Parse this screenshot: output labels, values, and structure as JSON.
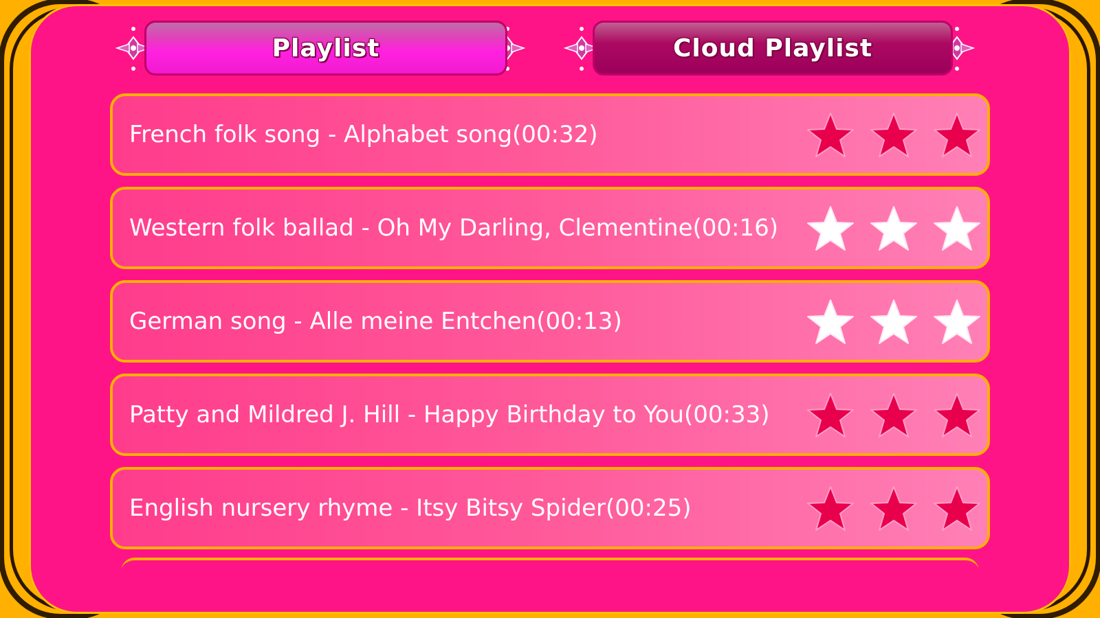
{
  "tabs": {
    "playlist_label": "Playlist",
    "cloud_playlist_label": "Cloud Playlist"
  },
  "songs": [
    {
      "title": "French folk song - Alphabet song(00:32)",
      "stars_filled": 3,
      "stars_total": 3
    },
    {
      "title": "Western folk ballad - Oh My Darling, Clementine(00:16)",
      "stars_filled": 0,
      "stars_total": 3
    },
    {
      "title": "German song - Alle meine Entchen(00:13)",
      "stars_filled": 0,
      "stars_total": 3
    },
    {
      "title": "Patty and Mildred J. Hill - Happy Birthday to You(00:33)",
      "stars_filled": 3,
      "stars_total": 3
    },
    {
      "title": "English nursery rhyme - Itsy Bitsy Spider(00:25)",
      "stars_filled": 3,
      "stars_total": 3
    }
  ],
  "colors": {
    "background": "#ffb000",
    "panel": "#fe1487",
    "star_filled": "#e8004c",
    "star_empty": "#ffffff",
    "row_border": "#ffb000"
  },
  "icons": {
    "tab_ornament": "flower-ornament-icon",
    "rating": "star-icon"
  }
}
